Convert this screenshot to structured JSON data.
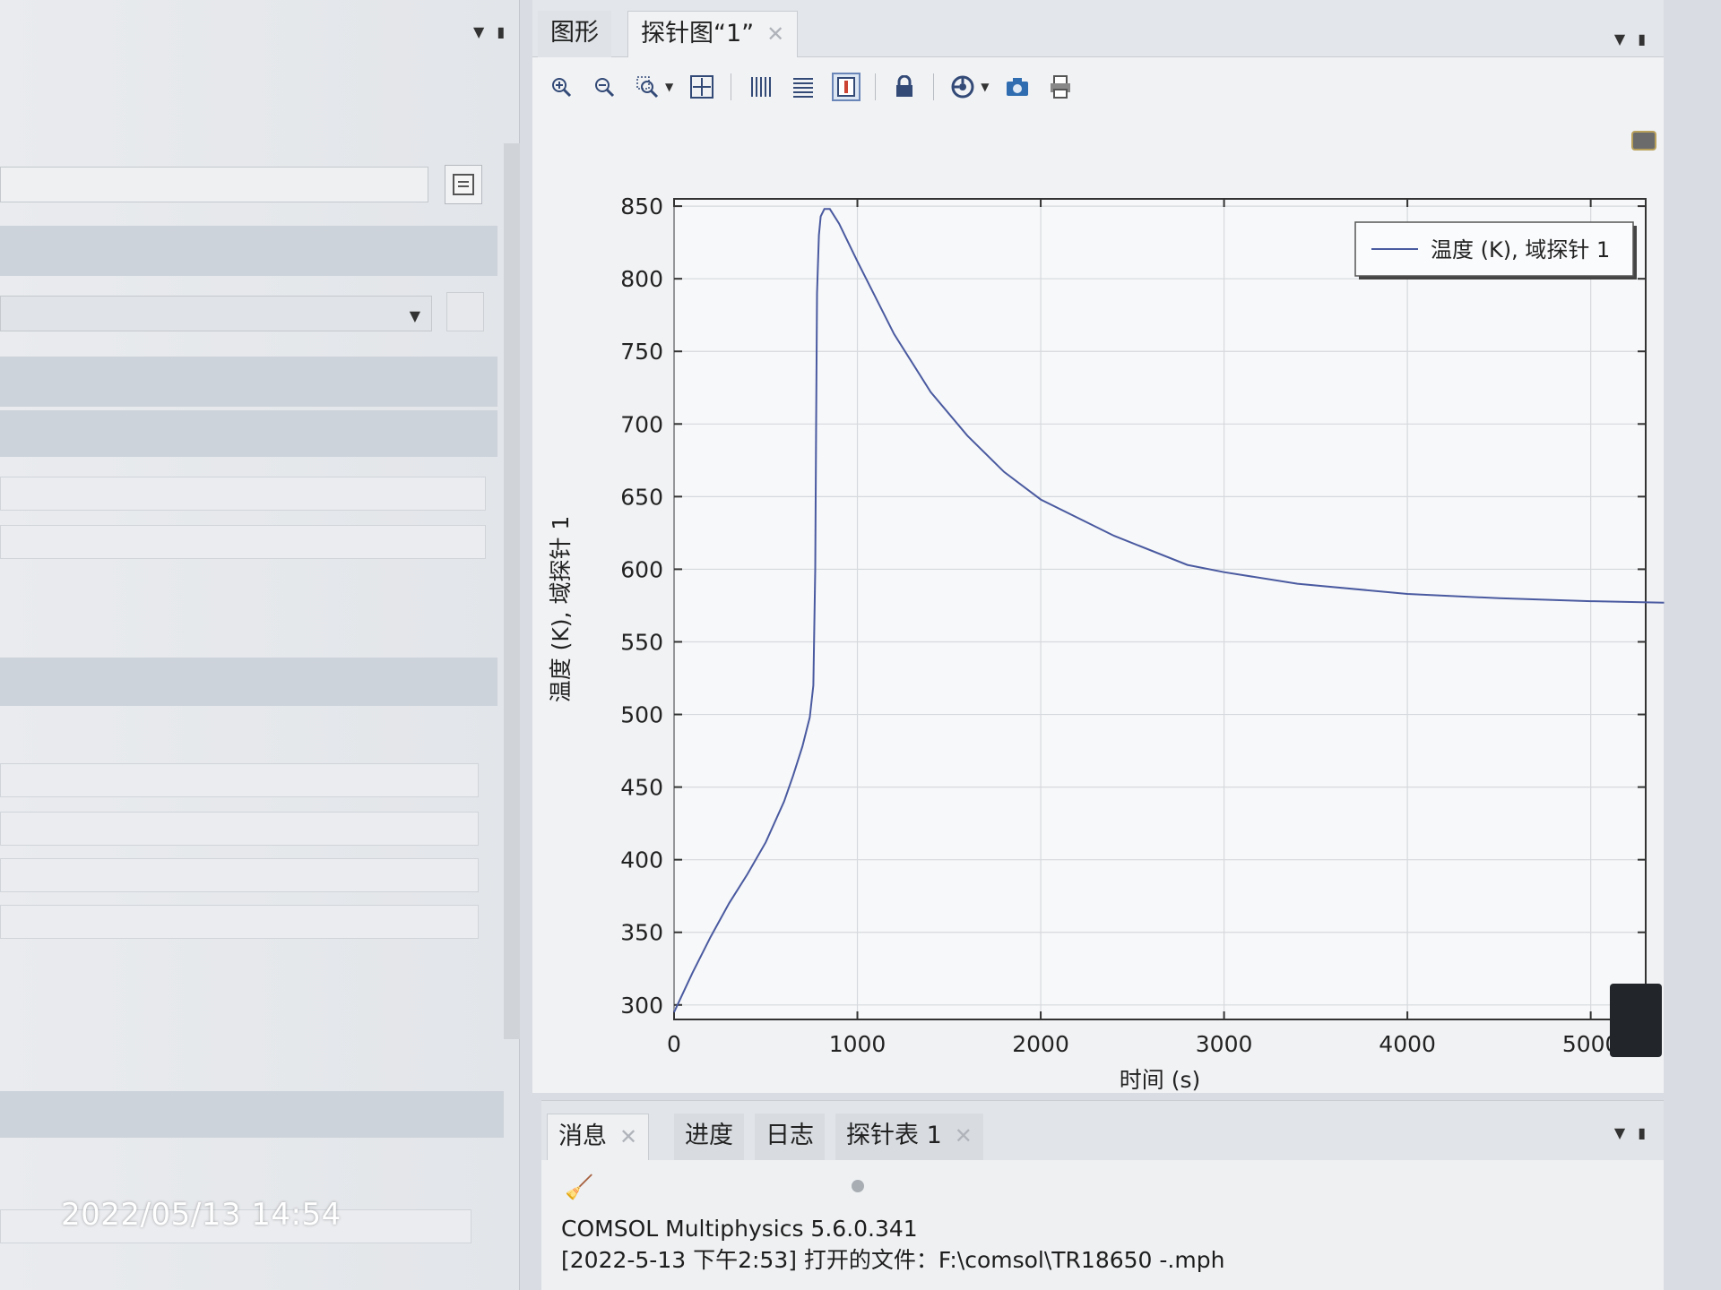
{
  "statusbar": {
    "timestamp": "2022/05/13 14:54"
  },
  "graphics": {
    "tabs": [
      {
        "label": "图形",
        "active": false
      },
      {
        "label": "探针图“1”",
        "active": true,
        "closable": true
      }
    ],
    "toolbar_icons": [
      "zoom-in-icon",
      "zoom-out-icon",
      "zoom-box-icon",
      "zoom-extents-icon",
      "vertical-grid-icon",
      "horizontal-grid-icon",
      "legend-toggle-icon",
      "lock-icon",
      "scene-light-icon",
      "screenshot-icon",
      "print-icon"
    ]
  },
  "messages": {
    "tabs": [
      {
        "label": "消息",
        "active": true,
        "closable": true
      },
      {
        "label": "进度",
        "active": false
      },
      {
        "label": "日志",
        "active": false
      },
      {
        "label": "探针表 1",
        "active": false,
        "closable": true
      }
    ],
    "lines": [
      "COMSOL Multiphysics 5.6.0.341",
      "[2022-5-13 下午2:53] 打开的文件：F:\\comsol\\TR18650 -.mph"
    ]
  },
  "chart_data": {
    "type": "line",
    "xlabel": "时间 (s)",
    "ylabel": "温度 (K), 域探针 1",
    "xlim": [
      0,
      5300
    ],
    "ylim": [
      290,
      855
    ],
    "x_ticks": [
      0,
      1000,
      2000,
      3000,
      4000,
      5000
    ],
    "y_ticks": [
      300,
      350,
      400,
      450,
      500,
      550,
      600,
      650,
      700,
      750,
      800,
      850
    ],
    "grid": true,
    "legend_position": "top-right",
    "line_color": "#4a5aa0",
    "series": [
      {
        "name": "温度 (K), 域探针 1",
        "x": [
          0,
          100,
          200,
          300,
          400,
          500,
          600,
          650,
          700,
          740,
          760,
          770,
          775,
          780,
          790,
          800,
          820,
          850,
          900,
          1000,
          1200,
          1400,
          1600,
          1800,
          2000,
          2400,
          2800,
          3000,
          3400,
          4000,
          4500,
          5000,
          5400
        ],
        "y": [
          295,
          322,
          347,
          370,
          390,
          412,
          440,
          458,
          478,
          498,
          520,
          600,
          700,
          790,
          830,
          843,
          848,
          848,
          838,
          812,
          762,
          722,
          692,
          667,
          648,
          623,
          603,
          598,
          590,
          583,
          580,
          578,
          577
        ]
      }
    ]
  }
}
